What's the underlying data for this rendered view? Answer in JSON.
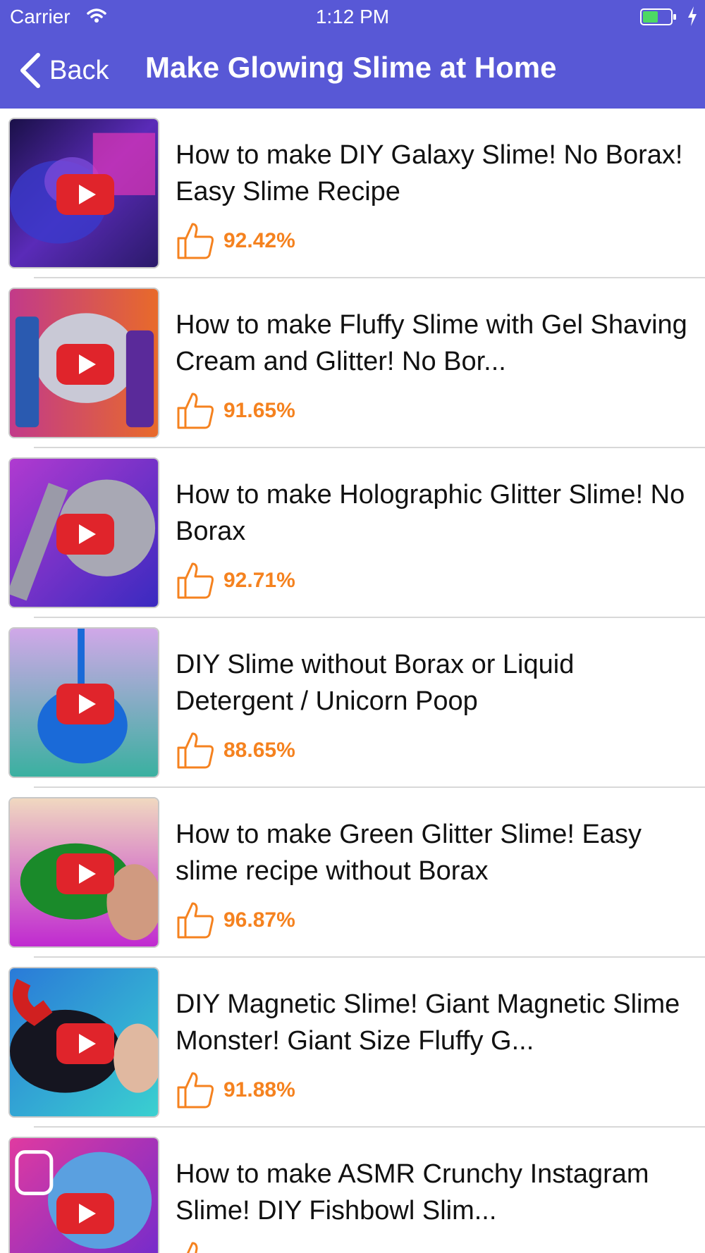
{
  "status_bar": {
    "carrier": "Carrier",
    "time": "1:12 PM"
  },
  "nav": {
    "back_label": "Back",
    "title": "Make Glowing Slime at Home"
  },
  "colors": {
    "nav_background": "#5858d6",
    "rating_orange": "#f5821f",
    "play_red": "#e0242b"
  },
  "videos": [
    {
      "title": "How to make DIY Galaxy Slime! No Borax!  Easy Slime Recipe",
      "rating": "92.42%"
    },
    {
      "title": "How to make Fluffy Slime with Gel Shaving Cream and Glitter! No Bor...",
      "rating": "91.65%"
    },
    {
      "title": "How to make Holographic Glitter Slime! No Borax",
      "rating": "92.71%"
    },
    {
      "title": "DIY Slime without Borax or Liquid Detergent / Unicorn Poop",
      "rating": "88.65%"
    },
    {
      "title": "How to make Green Glitter Slime! Easy slime recipe without Borax",
      "rating": "96.87%"
    },
    {
      "title": "DIY Magnetic Slime! Giant Magnetic Slime Monster! Giant Size Fluffy G...",
      "rating": "91.88%"
    },
    {
      "title": "How to make ASMR Crunchy Instagram Slime! DIY Fishbowl Slim...",
      "rating": ""
    }
  ]
}
